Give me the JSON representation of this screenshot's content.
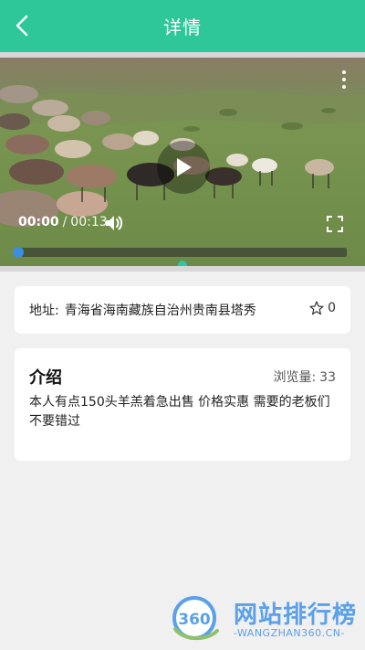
{
  "header": {
    "title": "详情",
    "accent": "#2ec79a"
  },
  "video": {
    "current_time": "00:00",
    "separator": "/",
    "total_time": "00:13",
    "progress": 0.0,
    "icons": {
      "play": "play-icon",
      "volume": "volume-icon",
      "fullscreen": "fullscreen-icon",
      "more": "more-vertical-icon"
    }
  },
  "address_card": {
    "label": "地址:",
    "value": "青海省海南藏族自治州贵南县塔秀",
    "favorite_count": "0"
  },
  "intro_card": {
    "title": "介绍",
    "views_label": "浏览量:",
    "views_value": "33",
    "text": "本人有点150头羊羔着急出售 价格实惠 需要的老板们不要错过"
  },
  "watermark": {
    "logo_text": "360",
    "title": "网站排行榜",
    "subtitle": "-WANGZHAN360.CN-"
  }
}
